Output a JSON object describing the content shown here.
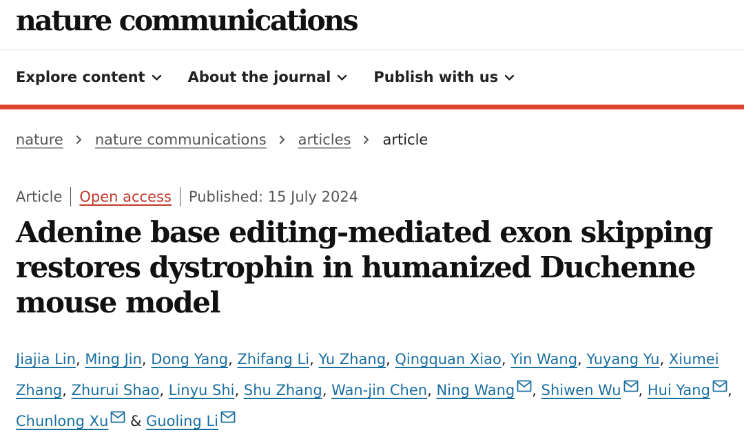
{
  "header": {
    "logo": "nature communications"
  },
  "nav": {
    "items": [
      "Explore content",
      "About the journal",
      "Publish with us"
    ]
  },
  "breadcrumb": {
    "items": [
      "nature",
      "nature communications",
      "articles"
    ],
    "current": "article"
  },
  "meta": {
    "type": "Article",
    "access": "Open access",
    "published": "Published: 15 July 2024"
  },
  "article": {
    "title": "Adenine base editing-mediated exon skipping restores dystrophin in humanized Duchenne mouse model"
  },
  "authors": {
    "names": [
      "Jiajia Lin",
      "Ming Jin",
      "Dong Yang",
      "Zhifang Li",
      "Yu Zhang",
      "Qingquan Xiao",
      "Yin Wang",
      "Yuyang Yu",
      "Xiumei Zhang",
      "Zhurui Shao",
      "Linyu Shi",
      "Shu Zhang",
      "Wan-jin Chen",
      "Ning Wang",
      "Shiwen Wu",
      "Hui Yang",
      "Chunlong Xu",
      "Guoling Li"
    ],
    "contact_authors": [
      "Ning Wang",
      "Shiwen Wu",
      "Hui Yang",
      "Chunlong Xu",
      "Guoling Li"
    ],
    "separator": ", ",
    "final_joiner": " & ",
    "mail_icon": "mail-icon"
  },
  "colors": {
    "accent_red": "#e0432b",
    "link_blue": "#1a6fa1",
    "open_access": "#c0392b"
  }
}
